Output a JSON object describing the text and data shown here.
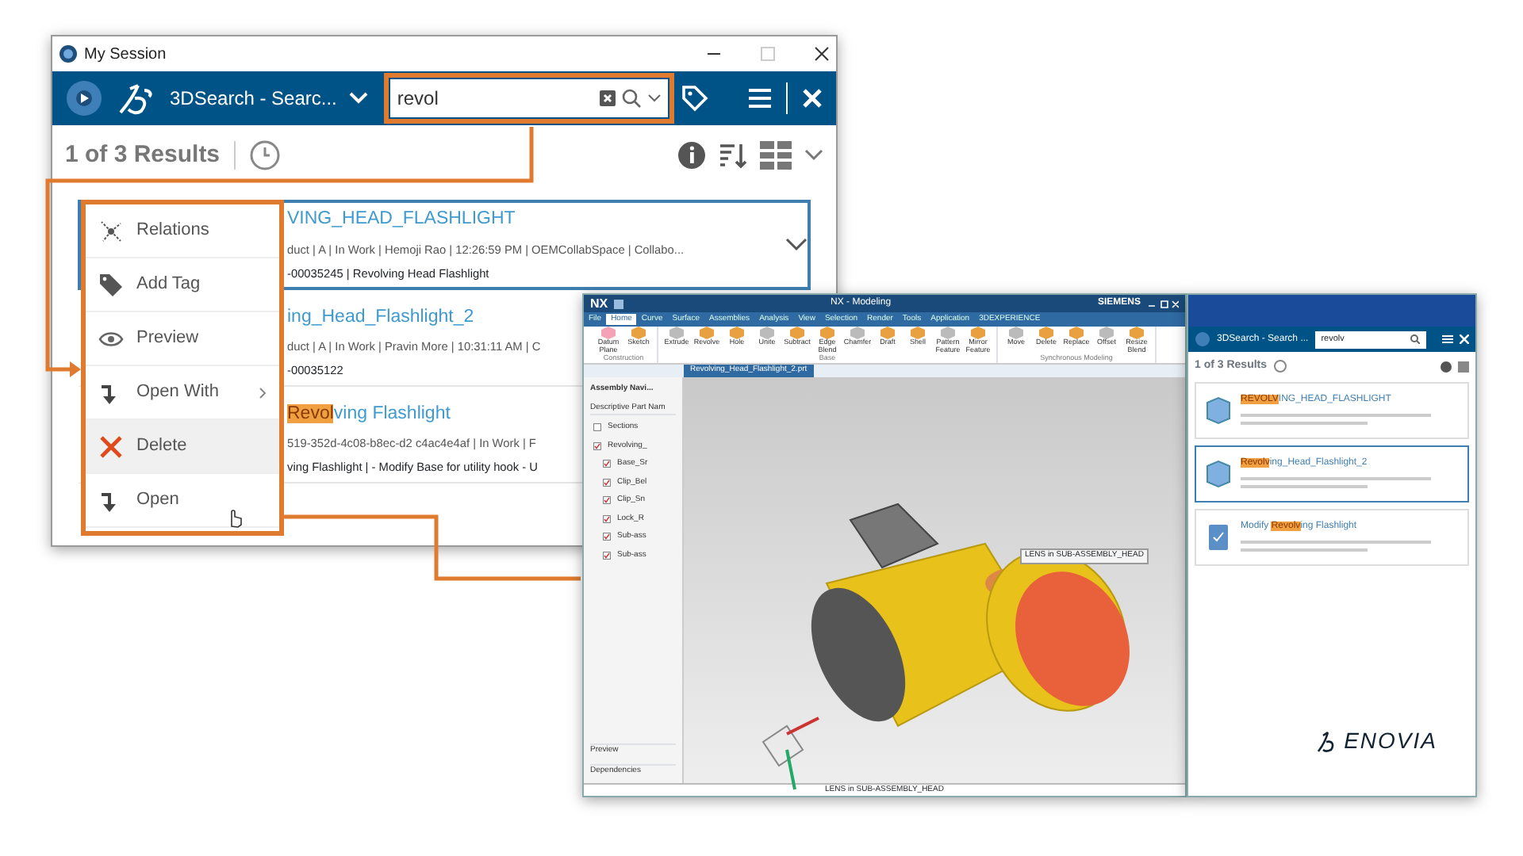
{
  "session_window": {
    "title": "My Session",
    "app_title": "3DSearch - Searc...",
    "search": {
      "value": "revol"
    },
    "result_count": "1 of 3 Results",
    "results": [
      {
        "title": "VING_HEAD_FLASHLIGHT",
        "details": "duct | A | In Work | Hemoji Rao | 12:26:59 PM | OEMCollabSpace | Collabo...",
        "id_line": "-00035245 | Revolving Head Flashlight",
        "selected": true
      },
      {
        "title": "ing_Head_Flashlight_2",
        "details": "duct | A | In Work | Pravin More | 10:31:11 AM | C",
        "id_line": "-00035122",
        "selected": false
      },
      {
        "highlight": "Revol",
        "title": "ving Flashlight",
        "details": "519-352d-4c08-b8ec-d2 c4ac4e4af | In Work | F",
        "id_line": "ving Flashlight | - Modify Base for utility hook - U",
        "selected": false
      }
    ],
    "context_menu": [
      {
        "label": "Relations",
        "kind": "relations",
        "submenu": false,
        "selected": false
      },
      {
        "label": "Add Tag",
        "kind": "tag",
        "submenu": false,
        "selected": false
      },
      {
        "label": "Preview",
        "kind": "eye",
        "submenu": false,
        "selected": false
      },
      {
        "label": "Open With",
        "kind": "open",
        "submenu": true,
        "selected": false
      },
      {
        "label": "Delete",
        "kind": "delete",
        "submenu": false,
        "selected": true
      },
      {
        "label": "Open",
        "kind": "open",
        "submenu": false,
        "selected": false
      }
    ]
  },
  "nx_window": {
    "logo": "NX",
    "title": "NX - Modeling",
    "brand": "SIEMENS",
    "menu_tabs": [
      {
        "label": "File",
        "selected": false
      },
      {
        "label": "Home",
        "selected": true
      },
      {
        "label": "Curve",
        "selected": false
      },
      {
        "label": "Surface",
        "selected": false
      },
      {
        "label": "Assemblies",
        "selected": false
      },
      {
        "label": "Analysis",
        "selected": false
      },
      {
        "label": "View",
        "selected": false
      },
      {
        "label": "Selection",
        "selected": false
      },
      {
        "label": "Render",
        "selected": false
      },
      {
        "label": "Tools",
        "selected": false
      },
      {
        "label": "Application",
        "selected": false
      },
      {
        "label": "3DEXPERIENCE",
        "selected": false
      }
    ],
    "ribbon_groups": [
      {
        "label": "Construction",
        "commands": [
          "Datum Plane",
          "Sketch"
        ]
      },
      {
        "label": "Base",
        "commands": [
          "Extrude",
          "Revolve",
          "Hole",
          "Unite",
          "Subtract",
          "Edge Blend",
          "Chamfer",
          "Draft",
          "Shell",
          "Pattern Feature",
          "Mirror Feature"
        ]
      },
      {
        "label": "Synchronous Modeling",
        "commands": [
          "Move",
          "Delete",
          "Replace",
          "Offset",
          "Resize Blend"
        ]
      }
    ],
    "part_tab": "Revolving_Head_Flashlight_2.prt",
    "navigator": {
      "title": "Assembly Navi...",
      "column": "Descriptive Part Nam",
      "tree": [
        {
          "label": "Sections",
          "checked": false
        },
        {
          "label": "Revolving_",
          "checked": true,
          "children": [
            {
              "label": "Base_Sr",
              "checked": true
            },
            {
              "label": "Clip_Bel",
              "checked": true
            },
            {
              "label": "Clip_Sn",
              "checked": true
            },
            {
              "label": "Lock_R",
              "checked": true
            },
            {
              "label": "Sub-ass",
              "checked": true
            },
            {
              "label": "Sub-ass",
              "checked": true
            }
          ]
        }
      ],
      "panels": [
        "Preview",
        "Dependencies"
      ]
    },
    "tooltip": "LENS in SUB-ASSEMBLY_HEAD",
    "status": "LENS in SUB-ASSEMBLY_HEAD"
  },
  "side_panel": {
    "app_title": "3DSearch - Search ...",
    "search": {
      "value": "revolv"
    },
    "result_count": "1 of 3 Results",
    "results": [
      {
        "kind": "product",
        "highlight": "REVOLV",
        "title": "ING_HEAD_FLASHLIGHT",
        "selected": false
      },
      {
        "kind": "product",
        "highlight": "Revolv",
        "title": "ing_Head_Flashlight_2",
        "selected": true
      },
      {
        "kind": "task",
        "prefix": "Modify ",
        "highlight": "Revolv",
        "title": "ing Flashlight",
        "selected": false
      }
    ],
    "logo": "ENOVIA"
  }
}
